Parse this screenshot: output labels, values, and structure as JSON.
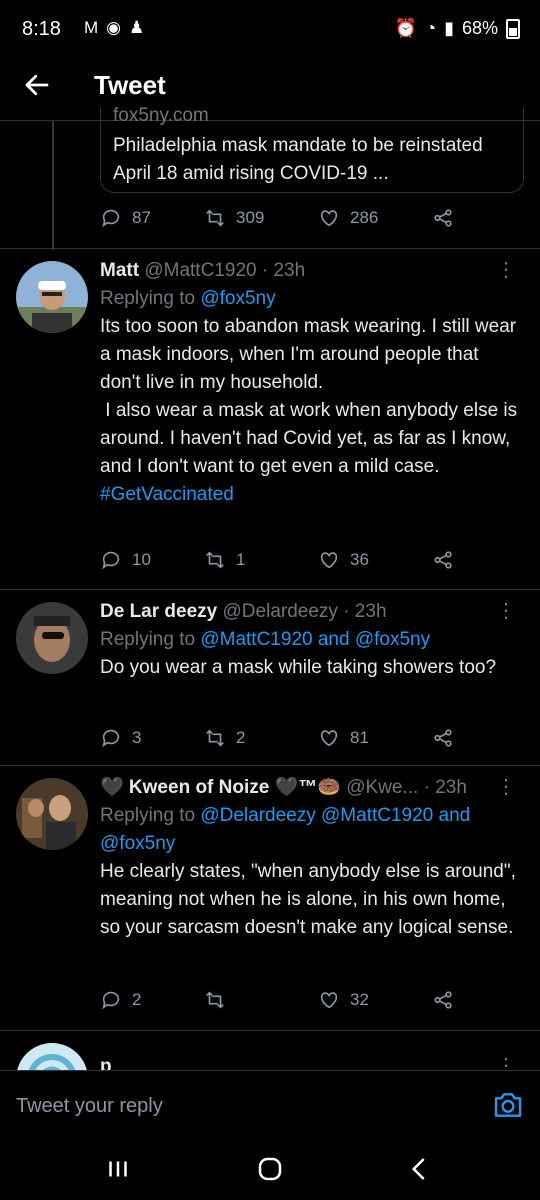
{
  "status": {
    "time": "8:18",
    "left_icons": [
      "gmail-icon",
      "app-icon",
      "notification-icon"
    ],
    "battery": "68%"
  },
  "topbar": {
    "title": "Tweet"
  },
  "card": {
    "domain": "fox5ny.com",
    "title": "Philadelphia mask mandate to be reinstated April 18 amid rising COVID-19 ..."
  },
  "main_actions": {
    "replies": "87",
    "retweets": "309",
    "likes": "286"
  },
  "replies": [
    {
      "name": "Matt",
      "handle": "@MattC1920",
      "time": "· 23h",
      "replying_label": "Replying to ",
      "replying_to": "@fox5ny",
      "text": "Its too soon to abandon mask wearing. I still wear a mask indoors, when I'm around people that don't live in my household.\n I also wear a mask at work when anybody else is around. I haven't had Covid yet, as far as I know, and I don't want to get even a mild case.",
      "hashtag": "#GetVaccinated",
      "replies": "10",
      "retweets": "1",
      "likes": "36"
    },
    {
      "name": "De Lar deezy",
      "handle": "@Delardeezy",
      "time": "· 23h",
      "replying_label": "Replying to ",
      "replying_to": "@MattC1920 and @fox5ny",
      "text": "Do you wear a mask while taking showers too?",
      "replies": "3",
      "retweets": "2",
      "likes": "81"
    },
    {
      "name": "🖤 Kween of Noize 🖤™🍩",
      "handle": "@Kwe...",
      "time": "· 23h",
      "replying_label": "Replying to ",
      "replying_to": "@Delardeezy @MattC1920 and @fox5ny",
      "text": "He clearly states, \"when anybody else is around\", meaning not when he is alone, in his own home, so your sarcasm doesn't make any logical sense.",
      "replies": "2",
      "retweets": "",
      "likes": "32"
    },
    {
      "name": "p"
    }
  ],
  "composer": {
    "placeholder": "Tweet your reply"
  },
  "colors": {
    "accent": "#1d9bf0",
    "background": "#000000",
    "muted": "#71767b"
  }
}
